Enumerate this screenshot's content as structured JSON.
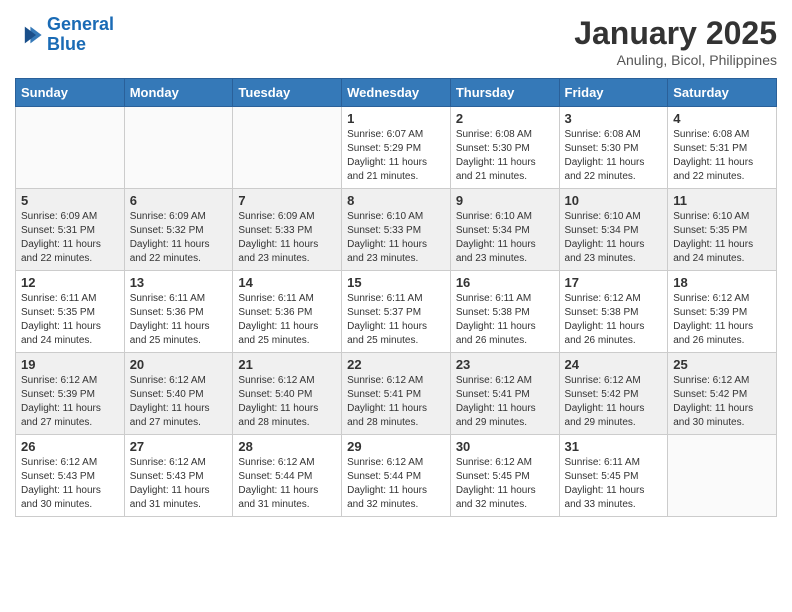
{
  "header": {
    "logo_line1": "General",
    "logo_line2": "Blue",
    "month_title": "January 2025",
    "subtitle": "Anuling, Bicol, Philippines"
  },
  "weekdays": [
    "Sunday",
    "Monday",
    "Tuesday",
    "Wednesday",
    "Thursday",
    "Friday",
    "Saturday"
  ],
  "weeks": [
    [
      {
        "day": "",
        "info": ""
      },
      {
        "day": "",
        "info": ""
      },
      {
        "day": "",
        "info": ""
      },
      {
        "day": "1",
        "info": "Sunrise: 6:07 AM\nSunset: 5:29 PM\nDaylight: 11 hours and 21 minutes."
      },
      {
        "day": "2",
        "info": "Sunrise: 6:08 AM\nSunset: 5:30 PM\nDaylight: 11 hours and 21 minutes."
      },
      {
        "day": "3",
        "info": "Sunrise: 6:08 AM\nSunset: 5:30 PM\nDaylight: 11 hours and 22 minutes."
      },
      {
        "day": "4",
        "info": "Sunrise: 6:08 AM\nSunset: 5:31 PM\nDaylight: 11 hours and 22 minutes."
      }
    ],
    [
      {
        "day": "5",
        "info": "Sunrise: 6:09 AM\nSunset: 5:31 PM\nDaylight: 11 hours and 22 minutes."
      },
      {
        "day": "6",
        "info": "Sunrise: 6:09 AM\nSunset: 5:32 PM\nDaylight: 11 hours and 22 minutes."
      },
      {
        "day": "7",
        "info": "Sunrise: 6:09 AM\nSunset: 5:33 PM\nDaylight: 11 hours and 23 minutes."
      },
      {
        "day": "8",
        "info": "Sunrise: 6:10 AM\nSunset: 5:33 PM\nDaylight: 11 hours and 23 minutes."
      },
      {
        "day": "9",
        "info": "Sunrise: 6:10 AM\nSunset: 5:34 PM\nDaylight: 11 hours and 23 minutes."
      },
      {
        "day": "10",
        "info": "Sunrise: 6:10 AM\nSunset: 5:34 PM\nDaylight: 11 hours and 23 minutes."
      },
      {
        "day": "11",
        "info": "Sunrise: 6:10 AM\nSunset: 5:35 PM\nDaylight: 11 hours and 24 minutes."
      }
    ],
    [
      {
        "day": "12",
        "info": "Sunrise: 6:11 AM\nSunset: 5:35 PM\nDaylight: 11 hours and 24 minutes."
      },
      {
        "day": "13",
        "info": "Sunrise: 6:11 AM\nSunset: 5:36 PM\nDaylight: 11 hours and 25 minutes."
      },
      {
        "day": "14",
        "info": "Sunrise: 6:11 AM\nSunset: 5:36 PM\nDaylight: 11 hours and 25 minutes."
      },
      {
        "day": "15",
        "info": "Sunrise: 6:11 AM\nSunset: 5:37 PM\nDaylight: 11 hours and 25 minutes."
      },
      {
        "day": "16",
        "info": "Sunrise: 6:11 AM\nSunset: 5:38 PM\nDaylight: 11 hours and 26 minutes."
      },
      {
        "day": "17",
        "info": "Sunrise: 6:12 AM\nSunset: 5:38 PM\nDaylight: 11 hours and 26 minutes."
      },
      {
        "day": "18",
        "info": "Sunrise: 6:12 AM\nSunset: 5:39 PM\nDaylight: 11 hours and 26 minutes."
      }
    ],
    [
      {
        "day": "19",
        "info": "Sunrise: 6:12 AM\nSunset: 5:39 PM\nDaylight: 11 hours and 27 minutes."
      },
      {
        "day": "20",
        "info": "Sunrise: 6:12 AM\nSunset: 5:40 PM\nDaylight: 11 hours and 27 minutes."
      },
      {
        "day": "21",
        "info": "Sunrise: 6:12 AM\nSunset: 5:40 PM\nDaylight: 11 hours and 28 minutes."
      },
      {
        "day": "22",
        "info": "Sunrise: 6:12 AM\nSunset: 5:41 PM\nDaylight: 11 hours and 28 minutes."
      },
      {
        "day": "23",
        "info": "Sunrise: 6:12 AM\nSunset: 5:41 PM\nDaylight: 11 hours and 29 minutes."
      },
      {
        "day": "24",
        "info": "Sunrise: 6:12 AM\nSunset: 5:42 PM\nDaylight: 11 hours and 29 minutes."
      },
      {
        "day": "25",
        "info": "Sunrise: 6:12 AM\nSunset: 5:42 PM\nDaylight: 11 hours and 30 minutes."
      }
    ],
    [
      {
        "day": "26",
        "info": "Sunrise: 6:12 AM\nSunset: 5:43 PM\nDaylight: 11 hours and 30 minutes."
      },
      {
        "day": "27",
        "info": "Sunrise: 6:12 AM\nSunset: 5:43 PM\nDaylight: 11 hours and 31 minutes."
      },
      {
        "day": "28",
        "info": "Sunrise: 6:12 AM\nSunset: 5:44 PM\nDaylight: 11 hours and 31 minutes."
      },
      {
        "day": "29",
        "info": "Sunrise: 6:12 AM\nSunset: 5:44 PM\nDaylight: 11 hours and 32 minutes."
      },
      {
        "day": "30",
        "info": "Sunrise: 6:12 AM\nSunset: 5:45 PM\nDaylight: 11 hours and 32 minutes."
      },
      {
        "day": "31",
        "info": "Sunrise: 6:11 AM\nSunset: 5:45 PM\nDaylight: 11 hours and 33 minutes."
      },
      {
        "day": "",
        "info": ""
      }
    ]
  ]
}
